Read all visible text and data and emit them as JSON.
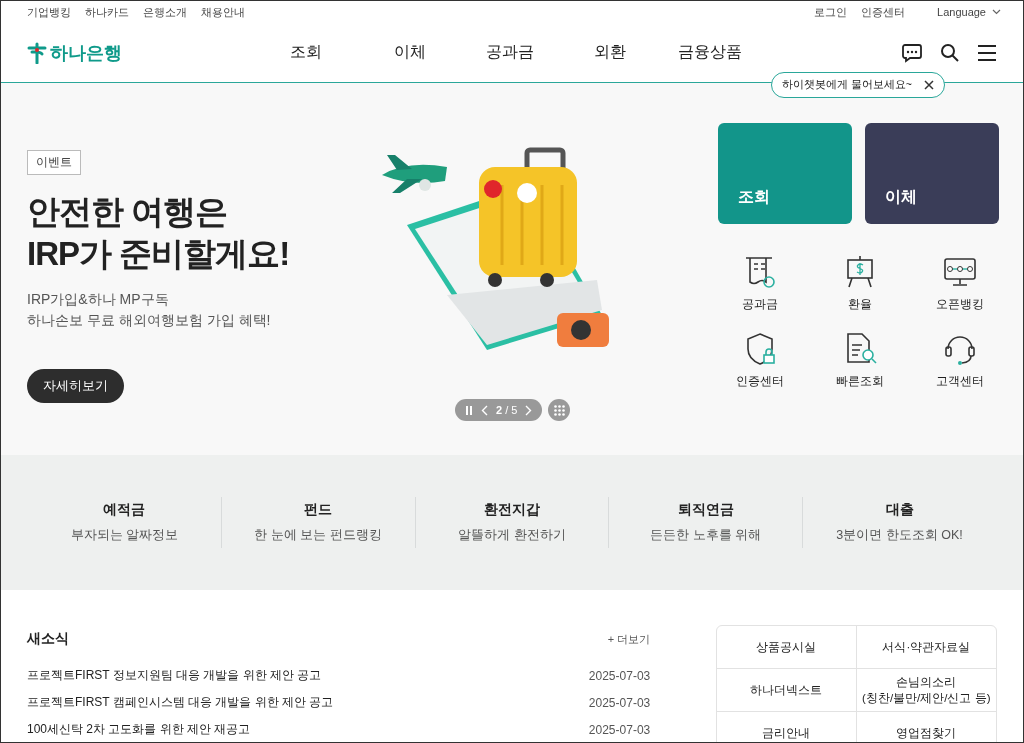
{
  "util_links": [
    "기업뱅킹",
    "하나카드",
    "은행소개",
    "채용안내"
  ],
  "util_right": [
    "로그인",
    "인증센터"
  ],
  "language": "Language",
  "logo": "하나은행",
  "nav": [
    "조회",
    "이체",
    "공과금",
    "외환",
    "금융상품"
  ],
  "chatbot_tip": "하이챗봇에게 물어보세요~",
  "hero": {
    "badge": "이벤트",
    "title": [
      "안전한 여행은",
      "IRP가 준비할게요!"
    ],
    "subtitle": [
      "IRP가입&하나 MP구독",
      "하나손보 무료 해외여행보험 가입 혜택!"
    ],
    "button": "자세히보기",
    "page": "**2** / 5"
  },
  "quick_cards": [
    {
      "label": "조회",
      "color": "#12958a"
    },
    {
      "label": "이체",
      "color": "#3a3d58"
    }
  ],
  "quick_menu": [
    "공과금",
    "환율",
    "오픈뱅킹",
    "인증센터",
    "빠른조회",
    "고객센터"
  ],
  "categories": [
    {
      "title": "예적금",
      "desc": "부자되는 알짜정보"
    },
    {
      "title": "펀드",
      "desc": "한 눈에 보는 펀드랭킹"
    },
    {
      "title": "환전지갑",
      "desc": "알뜰하게 환전하기"
    },
    {
      "title": "퇴직연금",
      "desc": "든든한 노후를 위해"
    },
    {
      "title": "대출",
      "desc": "3분이면 한도조회 OK!"
    }
  ],
  "news": {
    "title": "새소식",
    "more": "+ 더보기",
    "items": [
      {
        "text": "프로젝트FIRST 정보지원팀 대응 개발을 위한 제안 공고",
        "date": "2025-07-03"
      },
      {
        "text": "프로젝트FIRST 캠페인시스템 대응 개발을 위한 제안 공고",
        "date": "2025-07-03"
      },
      {
        "text": "100세신탁 2차 고도화를 위한 제안 재공고",
        "date": "2025-07-03"
      }
    ]
  },
  "links": [
    [
      "상품공시실",
      "서식·약관자료실"
    ],
    [
      "하나더넥스트",
      "손님의소리\n(칭찬/불만/제안/신고 등)"
    ],
    [
      "금리안내",
      "영업점찾기"
    ]
  ]
}
